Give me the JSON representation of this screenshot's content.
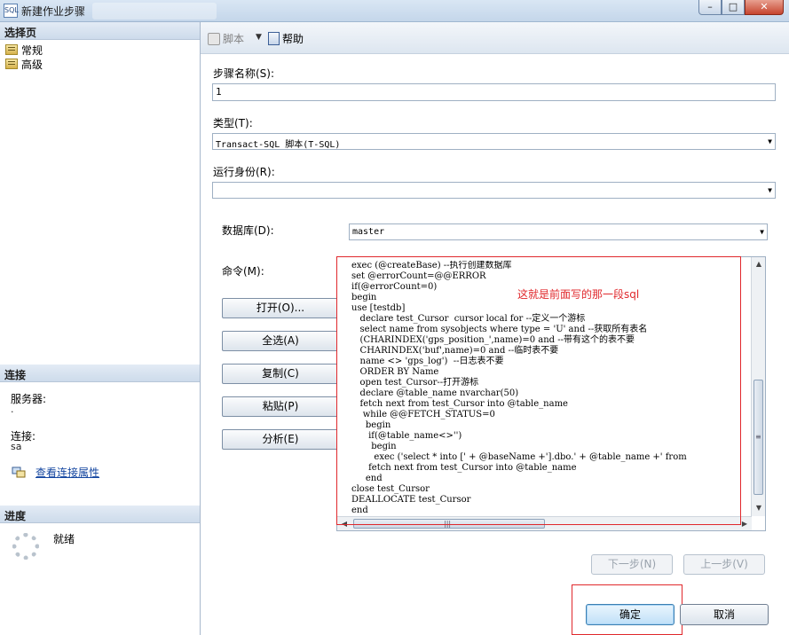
{
  "window": {
    "title": "新建作业步骤",
    "icon_text": "SQL",
    "controls": {
      "minimize": "–",
      "maximize": "□",
      "close": "✕"
    }
  },
  "left_pane": {
    "select_page_header": "选择页",
    "pages": [
      {
        "label": "常规",
        "icon": "page-icon"
      },
      {
        "label": "高级",
        "icon": "page-icon"
      }
    ],
    "connection_header": "连接",
    "server_label": "服务器:",
    "server_value": ".",
    "connection_label": "连接:",
    "connection_value": "sa",
    "view_connection_link": "查看连接属性",
    "progress_header": "进度",
    "progress_status": "就绪"
  },
  "toolbar": {
    "script_label": "脚本",
    "help_label": "帮助"
  },
  "form": {
    "step_name_label": "步骤名称(S):",
    "step_name_value": "1",
    "type_label": "类型(T):",
    "type_value": "Transact-SQL 脚本(T-SQL)",
    "run_as_label": "运行身份(R):",
    "run_as_value": "",
    "database_label": "数据库(D):",
    "database_value": "master",
    "command_label": "命令(M):"
  },
  "command_buttons": {
    "open": "打开(O)...",
    "select_all": "全选(A)",
    "copy": "复制(C)",
    "paste": "粘贴(P)",
    "parse": "分析(E)"
  },
  "editor": {
    "code_lines": [
      "exec (@createBase) --执行创建数据库",
      "set @errorCount=@@ERROR",
      "if(@errorCount=0)",
      "begin",
      "use [testdb]",
      "   declare test_Cursor  cursor local for --定义一个游标",
      "   select name from sysobjects where type = 'U' and --获取所有表名",
      "   (CHARINDEX('gps_position_',name)=0 and --带有这个的表不要",
      "   CHARINDEX('buf',name)=0 and --临时表不要",
      "   name <> 'gps_log')  --日志表不要",
      "   ORDER BY Name",
      "   open test_Cursor--打开游标",
      "   declare @table_name nvarchar(50)",
      "   fetch next from test_Cursor into @table_name",
      "    while @@FETCH_STATUS=0",
      "     begin",
      "      if(@table_name<>'')",
      "       begin",
      "        exec ('select * into [' + @baseName +'].dbo.' + @table_name +' from",
      "      fetch next from test_Cursor into @table_name",
      "     end",
      "close test_Cursor",
      "DEALLOCATE test_Cursor",
      "end"
    ],
    "annotation": "这就是前面写的那一段sql"
  },
  "navigation": {
    "next_step": "下一步(N)",
    "previous_step": "上一步(V)"
  },
  "dialog_buttons": {
    "ok": "确定",
    "cancel": "取消"
  },
  "colors": {
    "annotation_red": "#e0282c",
    "link_blue": "#1446a0",
    "header_bg": "#cddbeb"
  }
}
